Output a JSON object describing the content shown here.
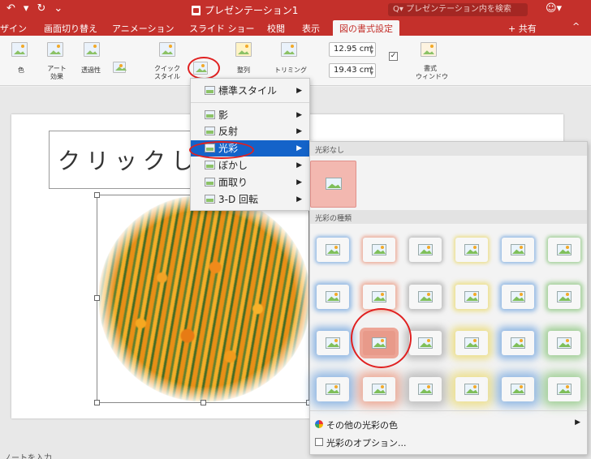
{
  "quick_access": {
    "undo": "↶",
    "undo_dd": "▾",
    "redo": "↻",
    "customize": "⌄"
  },
  "window": {
    "title": "プレゼンテーション1",
    "search_placeholder": "Q▾ プレゼンテーション内を検索",
    "smiley": "☺▾"
  },
  "tabs": [
    {
      "label": "ザイン"
    },
    {
      "label": "画面切り替え"
    },
    {
      "label": "アニメーション"
    },
    {
      "label": "スライド ショー"
    },
    {
      "label": "校閲"
    },
    {
      "label": "表示"
    },
    {
      "label": "図の書式設定"
    }
  ],
  "share": {
    "label": "共有",
    "icon": "+",
    "collapse": "^"
  },
  "ribbon": {
    "color_label": "色",
    "art_effect_label": "アート\n効果",
    "transparency_label": "透過性",
    "quick_style_label": "クイック\nスタイル",
    "arrange_label": "整列",
    "trim_label": "トリミング",
    "height_value": "12.95 cm",
    "width_value": "19.43 cm",
    "format_window_label": "書式\nウィンドウ"
  },
  "slide": {
    "title_text": "クリックして"
  },
  "notes": {
    "text": "ノートを入力"
  },
  "menu": {
    "items": [
      {
        "label": "標準スタイル"
      },
      {
        "label": "影"
      },
      {
        "label": "反射"
      },
      {
        "label": "光彩"
      },
      {
        "label": "ぼかし"
      },
      {
        "label": "面取り"
      },
      {
        "label": "3-D 回転"
      }
    ],
    "arrow": "▶"
  },
  "glow_panel": {
    "no_glow_header": "光彩なし",
    "variations_header": "光彩の種類",
    "more_colors": "その他の光彩の色",
    "options": "光彩のオプション...",
    "more_arrow": "▶",
    "glow_colors": [
      "#4f8fd8",
      "#e8795a",
      "#9a9a9a",
      "#e8d24a",
      "#4f8fd8",
      "#6ab85a"
    ]
  }
}
